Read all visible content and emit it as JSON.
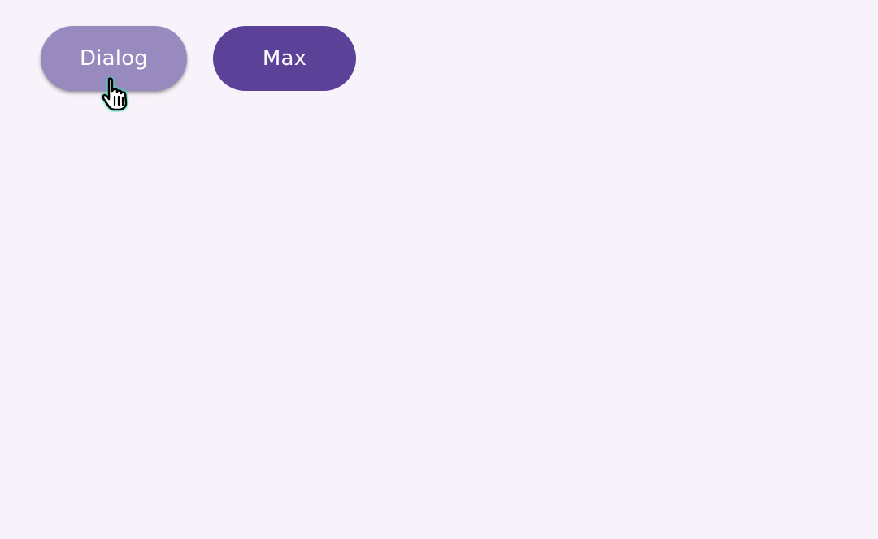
{
  "buttons": {
    "dialog_label": "Dialog",
    "max_label": "Max"
  },
  "colors": {
    "background": "#f8f3fa",
    "dialog_button": "#988abf",
    "max_button": "#5b4197",
    "cursor_glow": "#3fe0b8"
  },
  "cursor": {
    "icon": "hand-pointer-icon"
  }
}
